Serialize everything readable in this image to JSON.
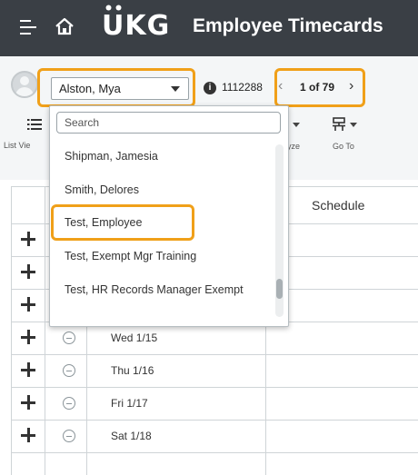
{
  "header": {
    "app_title": "Employee Timecards",
    "logo_text": "UKG",
    "menu_icon": "hamburger-icon",
    "home_icon": "home-icon"
  },
  "employee_picker": {
    "selected": "Alston, Mya",
    "employee_id": "1112288",
    "pager": "1 of 79"
  },
  "toolbar": {
    "list_view_label": "List Vie",
    "analyze_label": "yze",
    "goto_label": "Go To"
  },
  "dropdown": {
    "search_placeholder": "Search",
    "options": [
      "Shipman, Jamesia",
      "Smith, Delores",
      "Test, Employee",
      "Test, Exempt Mgr Training",
      "Test, HR Records Manager Exempt"
    ],
    "highlighted": "Test, Employee"
  },
  "table": {
    "columns": {
      "schedule": "Schedule"
    },
    "rows": [
      {
        "date": ""
      },
      {
        "date": ""
      },
      {
        "date": ""
      },
      {
        "date": "Wed 1/15"
      },
      {
        "date": "Thu 1/16"
      },
      {
        "date": "Fri 1/17"
      },
      {
        "date": "Sat 1/18"
      }
    ]
  },
  "colors": {
    "header_bg": "#3a3f45",
    "highlight": "#f0a019"
  }
}
